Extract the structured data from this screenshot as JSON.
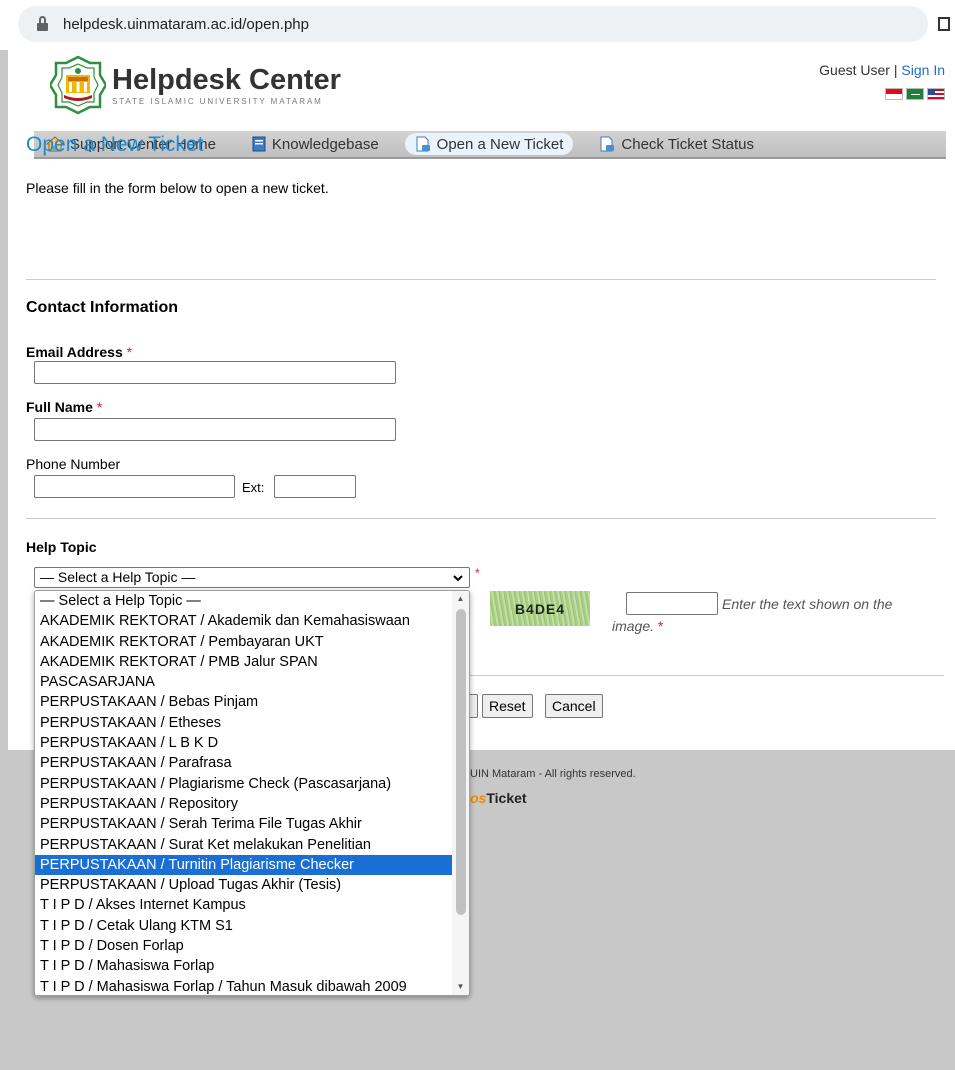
{
  "browser": {
    "url": "helpdesk.uinmataram.ac.id/open.php"
  },
  "header": {
    "logo_title": "Helpdesk Center",
    "logo_subtitle": "STATE ISLAMIC UNIVERSITY MATARAM",
    "guest_user": "Guest User",
    "separator": " | ",
    "sign_in": "Sign In"
  },
  "nav": {
    "items": [
      {
        "label": "Support Center Home",
        "icon": "home-icon"
      },
      {
        "label": "Knowledgebase",
        "icon": "book-icon"
      },
      {
        "label": "Open a New Ticket",
        "icon": "new-ticket-icon",
        "active": true
      },
      {
        "label": "Check Ticket Status",
        "icon": "ticket-status-icon"
      }
    ]
  },
  "main": {
    "title": "Open a New Ticket",
    "intro": "Please fill in the form below to open a new ticket.",
    "contact_section": "Contact Information",
    "email_label": "Email Address",
    "fullname_label": "Full Name",
    "phone_label": "Phone Number",
    "ext_label": "Ext:",
    "required_mark": "*",
    "help_topic_label": "Help Topic",
    "help_topic_selected": "— Select a Help Topic —",
    "captcha_text": "B4DE4",
    "captcha_hint_1": "Enter the text shown on the",
    "captcha_hint_2": "image.",
    "reset_button": "Reset",
    "cancel_button": "Cancel"
  },
  "footer": {
    "copyright": "UIN Mataram - All rights reserved.",
    "powered_os": "os",
    "powered_ticket": "Ticket"
  },
  "dropdown": {
    "selected_index": 13,
    "options": [
      "— Select a Help Topic —",
      "AKADEMIK REKTORAT / Akademik dan Kemahasiswaan",
      "AKADEMIK REKTORAT / Pembayaran UKT",
      "AKADEMIK REKTORAT / PMB Jalur SPAN",
      "PASCASARJANA",
      "PERPUSTAKAAN / Bebas Pinjam",
      "PERPUSTAKAAN / Etheses",
      "PERPUSTAKAAN / L B K D",
      "PERPUSTAKAAN / Parafrasa",
      "PERPUSTAKAAN / Plagiarisme Check (Pascasarjana)",
      "PERPUSTAKAAN / Repository",
      "PERPUSTAKAAN / Serah Terima File Tugas Akhir",
      "PERPUSTAKAAN / Surat Ket melakukan Penelitian",
      "PERPUSTAKAAN / Turnitin Plagiarisme Checker",
      "PERPUSTAKAAN / Upload Tugas Akhir (Tesis)",
      "T I P D / Akses Internet Kampus",
      "T I P D / Cetak Ulang KTM S1",
      "T I P D / Dosen Forlap",
      "T I P D / Mahasiswa Forlap",
      "T I P D / Mahasiswa Forlap / Tahun Masuk dibawah 2009"
    ]
  },
  "colors": {
    "link": "#1f6fb9",
    "title": "#1f8ad0",
    "required": "#e02020",
    "selection": "#1a6fd4"
  }
}
